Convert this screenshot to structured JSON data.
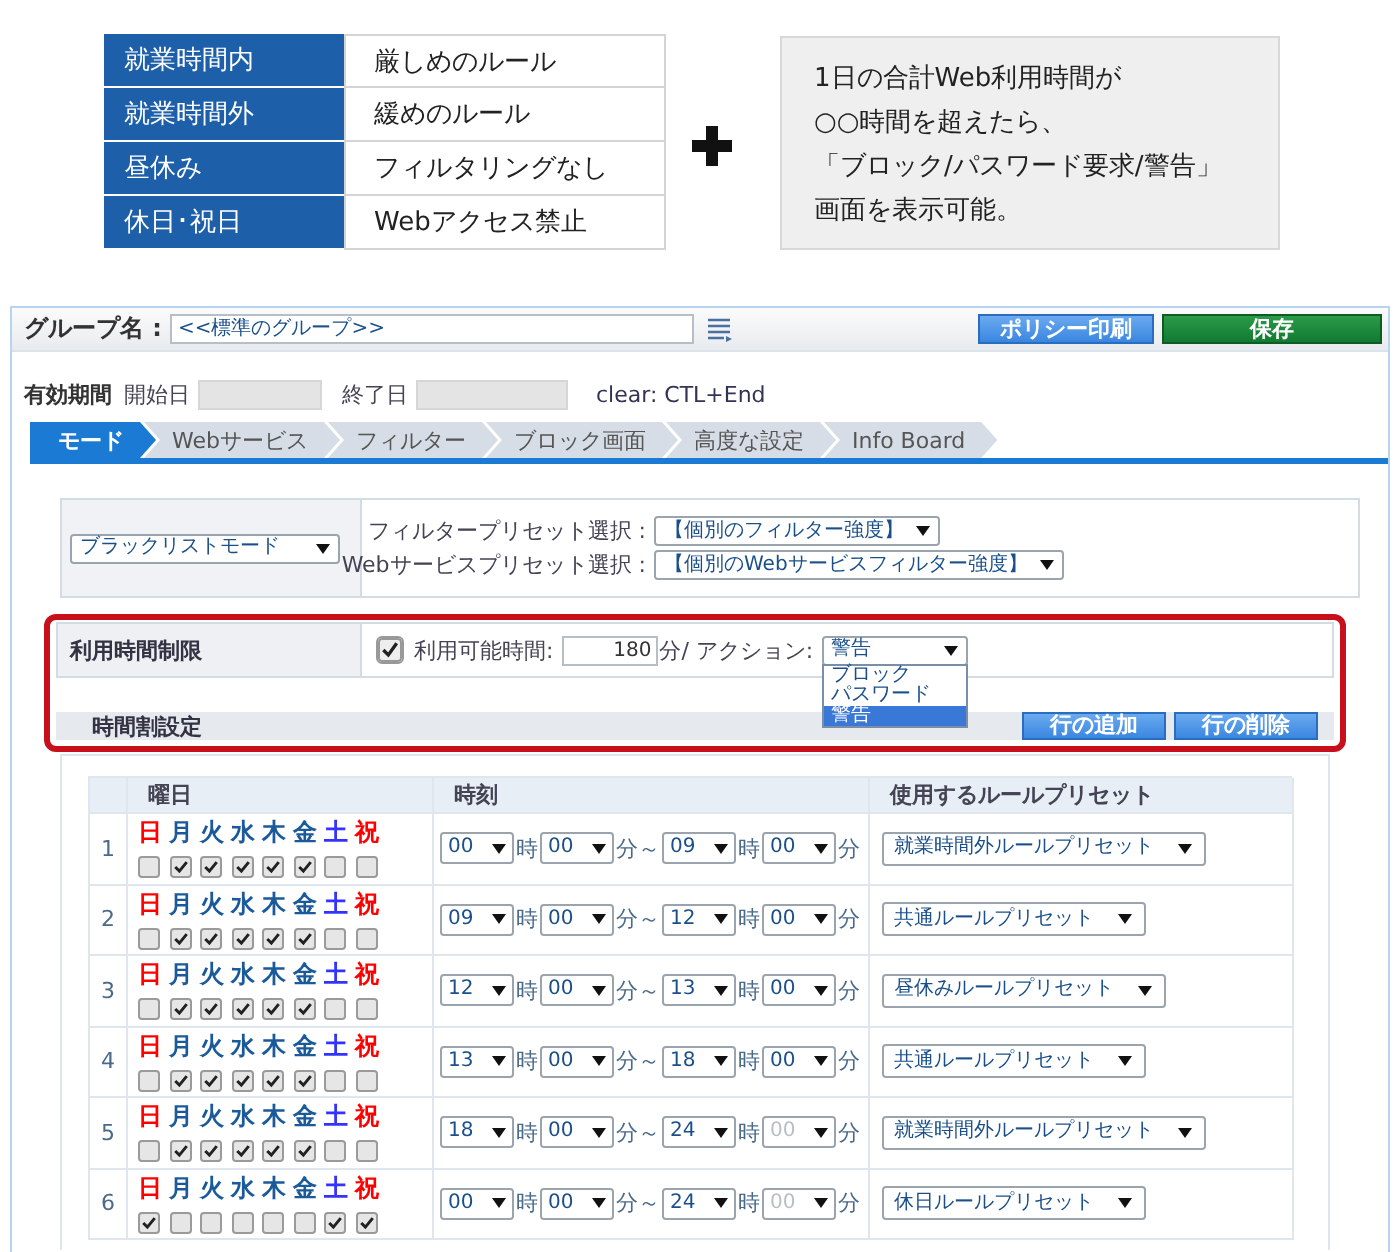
{
  "legend": {
    "rows": [
      {
        "label": "就業時間内",
        "rule": "厳しめのルール"
      },
      {
        "label": "就業時間外",
        "rule": "緩めのルール"
      },
      {
        "label": "昼休み",
        "rule": "フィルタリングなし"
      },
      {
        "label": "休日･祝日",
        "rule": "Webアクセス禁止"
      }
    ],
    "note": [
      "1日の合計Web利用時間が",
      "○○時間を超えたら、",
      "「ブロック/パスワード要求/警告」",
      "画面を表示可能。"
    ]
  },
  "header": {
    "group_label": "グループ名 :",
    "group_value": "<<標準のグループ>>",
    "buttons": [
      {
        "label": "ポリシー印刷",
        "kind": "primary"
      },
      {
        "label": "保存",
        "kind": "save"
      }
    ]
  },
  "period": {
    "label": "有効期間",
    "start_label": "開始日",
    "end_label": "終了日",
    "hint": "clear: CTL+End"
  },
  "tabs": [
    {
      "label": "モード",
      "selected": true
    },
    {
      "label": "Webサービス",
      "selected": false
    },
    {
      "label": "フィルター",
      "selected": false
    },
    {
      "label": "ブロック画面",
      "selected": false
    },
    {
      "label": "高度な設定",
      "selected": false
    },
    {
      "label": "Info Board",
      "selected": false
    }
  ],
  "mode": {
    "value": "ブラックリストモード",
    "presets": [
      {
        "label": "フィルタープリセット選択 :",
        "value": "【個別のフィルター強度】"
      },
      {
        "label": "Webサービスプリセット選択 :",
        "value": "【個別のWebサービスフィルター強度】"
      }
    ]
  },
  "time_limit": {
    "label": "利用時間制限",
    "enabled": true,
    "minutes_label": "利用可能時間:",
    "minutes": "180",
    "unit": "分/ アクション:",
    "action": {
      "value": "警告",
      "expanded": true,
      "options": [
        {
          "label": "ブロック",
          "selected": false
        },
        {
          "label": "パスワード",
          "selected": false
        },
        {
          "label": "警告",
          "selected": true
        }
      ]
    }
  },
  "schedule": {
    "title": "時間割設定",
    "buttons": [
      "行の追加",
      "行の削除"
    ],
    "columns": [
      "曜日",
      "時刻",
      "使用するルールプリセット"
    ],
    "rows": [
      {
        "number": "1",
        "days": [
          {
            "label": "日",
            "color": "#ff0000",
            "checked": false
          },
          {
            "label": "月",
            "color": "#1a5a9a",
            "checked": true
          },
          {
            "label": "火",
            "color": "#1a5a9a",
            "checked": true
          },
          {
            "label": "水",
            "color": "#1a5a9a",
            "checked": true
          },
          {
            "label": "木",
            "color": "#1a5a9a",
            "checked": true
          },
          {
            "label": "金",
            "color": "#1a5a9a",
            "checked": true
          },
          {
            "label": "土",
            "color": "#3333ff",
            "checked": false
          },
          {
            "label": "祝",
            "color": "#ff0000",
            "checked": false
          }
        ],
        "time": [
          {
            "kind": "select",
            "value": "00",
            "disabled": false
          },
          {
            "kind": "unit",
            "text": "時"
          },
          {
            "kind": "select",
            "value": "00",
            "disabled": false
          },
          {
            "kind": "unit",
            "text": "分～"
          },
          {
            "kind": "select",
            "value": "09",
            "disabled": false
          },
          {
            "kind": "unit",
            "text": "時"
          },
          {
            "kind": "select",
            "value": "00",
            "disabled": false
          },
          {
            "kind": "unit",
            "text": "分"
          }
        ],
        "preset": "就業時間外ルールプリセット"
      },
      {
        "number": "2",
        "days": [
          {
            "label": "日",
            "color": "#ff0000",
            "checked": false
          },
          {
            "label": "月",
            "color": "#1a5a9a",
            "checked": true
          },
          {
            "label": "火",
            "color": "#1a5a9a",
            "checked": true
          },
          {
            "label": "水",
            "color": "#1a5a9a",
            "checked": true
          },
          {
            "label": "木",
            "color": "#1a5a9a",
            "checked": true
          },
          {
            "label": "金",
            "color": "#1a5a9a",
            "checked": true
          },
          {
            "label": "土",
            "color": "#3333ff",
            "checked": false
          },
          {
            "label": "祝",
            "color": "#ff0000",
            "checked": false
          }
        ],
        "time": [
          {
            "kind": "select",
            "value": "09",
            "disabled": false
          },
          {
            "kind": "unit",
            "text": "時"
          },
          {
            "kind": "select",
            "value": "00",
            "disabled": false
          },
          {
            "kind": "unit",
            "text": "分～"
          },
          {
            "kind": "select",
            "value": "12",
            "disabled": false
          },
          {
            "kind": "unit",
            "text": "時"
          },
          {
            "kind": "select",
            "value": "00",
            "disabled": false
          },
          {
            "kind": "unit",
            "text": "分"
          }
        ],
        "preset": "共通ルールプリセット"
      },
      {
        "number": "3",
        "days": [
          {
            "label": "日",
            "color": "#ff0000",
            "checked": false
          },
          {
            "label": "月",
            "color": "#1a5a9a",
            "checked": true
          },
          {
            "label": "火",
            "color": "#1a5a9a",
            "checked": true
          },
          {
            "label": "水",
            "color": "#1a5a9a",
            "checked": true
          },
          {
            "label": "木",
            "color": "#1a5a9a",
            "checked": true
          },
          {
            "label": "金",
            "color": "#1a5a9a",
            "checked": true
          },
          {
            "label": "土",
            "color": "#3333ff",
            "checked": false
          },
          {
            "label": "祝",
            "color": "#ff0000",
            "checked": false
          }
        ],
        "time": [
          {
            "kind": "select",
            "value": "12",
            "disabled": false
          },
          {
            "kind": "unit",
            "text": "時"
          },
          {
            "kind": "select",
            "value": "00",
            "disabled": false
          },
          {
            "kind": "unit",
            "text": "分～"
          },
          {
            "kind": "select",
            "value": "13",
            "disabled": false
          },
          {
            "kind": "unit",
            "text": "時"
          },
          {
            "kind": "select",
            "value": "00",
            "disabled": false
          },
          {
            "kind": "unit",
            "text": "分"
          }
        ],
        "preset": "昼休みルールプリセット"
      },
      {
        "number": "4",
        "days": [
          {
            "label": "日",
            "color": "#ff0000",
            "checked": false
          },
          {
            "label": "月",
            "color": "#1a5a9a",
            "checked": true
          },
          {
            "label": "火",
            "color": "#1a5a9a",
            "checked": true
          },
          {
            "label": "水",
            "color": "#1a5a9a",
            "checked": true
          },
          {
            "label": "木",
            "color": "#1a5a9a",
            "checked": true
          },
          {
            "label": "金",
            "color": "#1a5a9a",
            "checked": true
          },
          {
            "label": "土",
            "color": "#3333ff",
            "checked": false
          },
          {
            "label": "祝",
            "color": "#ff0000",
            "checked": false
          }
        ],
        "time": [
          {
            "kind": "select",
            "value": "13",
            "disabled": false
          },
          {
            "kind": "unit",
            "text": "時"
          },
          {
            "kind": "select",
            "value": "00",
            "disabled": false
          },
          {
            "kind": "unit",
            "text": "分～"
          },
          {
            "kind": "select",
            "value": "18",
            "disabled": false
          },
          {
            "kind": "unit",
            "text": "時"
          },
          {
            "kind": "select",
            "value": "00",
            "disabled": false
          },
          {
            "kind": "unit",
            "text": "分"
          }
        ],
        "preset": "共通ルールプリセット"
      },
      {
        "number": "5",
        "days": [
          {
            "label": "日",
            "color": "#ff0000",
            "checked": false
          },
          {
            "label": "月",
            "color": "#1a5a9a",
            "checked": true
          },
          {
            "label": "火",
            "color": "#1a5a9a",
            "checked": true
          },
          {
            "label": "水",
            "color": "#1a5a9a",
            "checked": true
          },
          {
            "label": "木",
            "color": "#1a5a9a",
            "checked": true
          },
          {
            "label": "金",
            "color": "#1a5a9a",
            "checked": true
          },
          {
            "label": "土",
            "color": "#3333ff",
            "checked": false
          },
          {
            "label": "祝",
            "color": "#ff0000",
            "checked": false
          }
        ],
        "time": [
          {
            "kind": "select",
            "value": "18",
            "disabled": false
          },
          {
            "kind": "unit",
            "text": "時"
          },
          {
            "kind": "select",
            "value": "00",
            "disabled": false
          },
          {
            "kind": "unit",
            "text": "分～"
          },
          {
            "kind": "select",
            "value": "24",
            "disabled": false
          },
          {
            "kind": "unit",
            "text": "時"
          },
          {
            "kind": "select",
            "value": "00",
            "disabled": true
          },
          {
            "kind": "unit",
            "text": "分"
          }
        ],
        "preset": "就業時間外ルールプリセット"
      },
      {
        "number": "6",
        "days": [
          {
            "label": "日",
            "color": "#ff0000",
            "checked": true
          },
          {
            "label": "月",
            "color": "#1a5a9a",
            "checked": false
          },
          {
            "label": "火",
            "color": "#1a5a9a",
            "checked": false
          },
          {
            "label": "水",
            "color": "#1a5a9a",
            "checked": false
          },
          {
            "label": "木",
            "color": "#1a5a9a",
            "checked": false
          },
          {
            "label": "金",
            "color": "#1a5a9a",
            "checked": false
          },
          {
            "label": "土",
            "color": "#3333ff",
            "checked": true
          },
          {
            "label": "祝",
            "color": "#ff0000",
            "checked": true
          }
        ],
        "time": [
          {
            "kind": "select",
            "value": "00",
            "disabled": false
          },
          {
            "kind": "unit",
            "text": "時"
          },
          {
            "kind": "select",
            "value": "00",
            "disabled": false
          },
          {
            "kind": "unit",
            "text": "分～"
          },
          {
            "kind": "select",
            "value": "24",
            "disabled": false
          },
          {
            "kind": "unit",
            "text": "時"
          },
          {
            "kind": "select",
            "value": "00",
            "disabled": true
          },
          {
            "kind": "unit",
            "text": "分"
          }
        ],
        "preset": "休日ルールプリセット"
      }
    ]
  }
}
